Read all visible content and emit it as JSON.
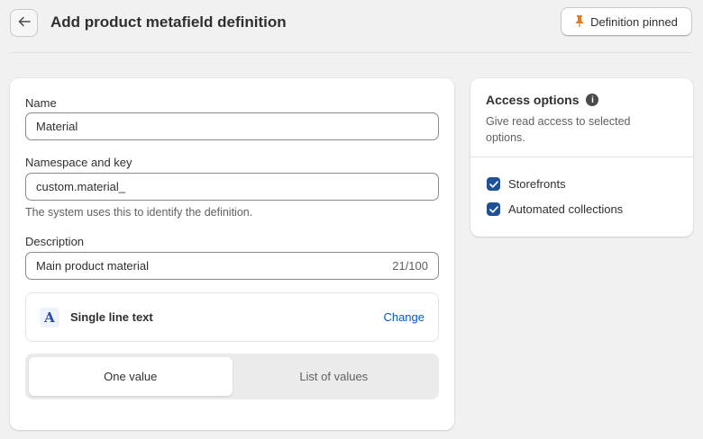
{
  "header": {
    "title": "Add product metafield definition",
    "pin_button_label": "Definition pinned"
  },
  "form": {
    "name_label": "Name",
    "name_value": "Material",
    "namespace_label": "Namespace and key",
    "namespace_value": "custom.material_",
    "namespace_help": "The system uses this to identify the definition.",
    "description_label": "Description",
    "description_value": "Main product material",
    "description_count": "21/100",
    "type": {
      "icon_glyph": "A",
      "name": "Single line text",
      "change_label": "Change"
    },
    "value_mode": {
      "options": [
        "One value",
        "List of values"
      ],
      "selected": "One value"
    }
  },
  "access": {
    "title": "Access options",
    "info_glyph": "i",
    "subtitle": "Give read access to selected options.",
    "options": [
      {
        "label": "Storefronts",
        "checked": true
      },
      {
        "label": "Automated collections",
        "checked": true
      }
    ]
  },
  "colors": {
    "accent": "#005bd3",
    "checkbox": "#1f5199",
    "pin_icon": "#e8791f"
  }
}
